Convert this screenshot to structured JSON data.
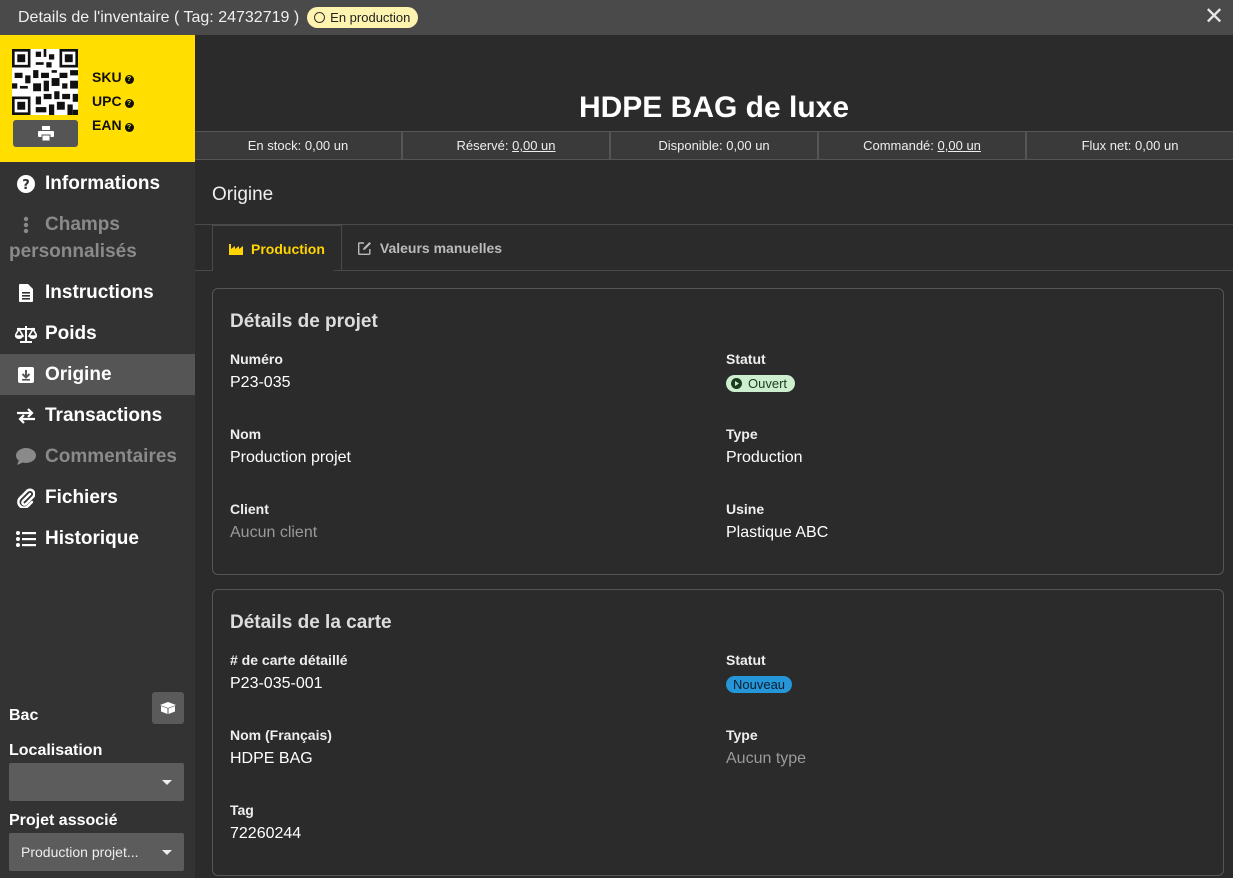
{
  "window": {
    "title": "Details de l'inventaire ( Tag: 24732719 )",
    "status_badge": "En production",
    "close_label": "✕"
  },
  "identifiers": [
    "SKU",
    "UPC",
    "EAN"
  ],
  "nav": {
    "items": [
      {
        "label": "Informations",
        "icon": "question-circle-icon"
      },
      {
        "label": "Champs personnalisés",
        "line1": "Champs",
        "line2": "personnalisés",
        "icon": "vertical-ellipsis-icon",
        "disabled": true
      },
      {
        "label": "Instructions",
        "icon": "document-icon"
      },
      {
        "label": "Poids",
        "icon": "balance-scale-icon"
      },
      {
        "label": "Origine",
        "icon": "download-box-icon",
        "active": true
      },
      {
        "label": "Transactions",
        "icon": "exchange-arrows-icon"
      },
      {
        "label": "Commentaires",
        "icon": "comment-icon",
        "disabled": true
      },
      {
        "label": "Fichiers",
        "icon": "paperclip-icon"
      },
      {
        "label": "Historique",
        "icon": "list-icon"
      }
    ]
  },
  "sidebar_bottom": {
    "bac_label": "Bac",
    "localisation_label": "Localisation",
    "localisation_value": "",
    "projet_label": "Projet associé",
    "projet_value": "Production projet..."
  },
  "header": {
    "product_name": "HDPE BAG de luxe"
  },
  "stats": {
    "en_stock_label": "En stock:",
    "en_stock_value": "0,00 un",
    "reserve_label": "Réservé:",
    "reserve_value": "0,00 un",
    "disponible_label": "Disponible:",
    "disponible_value": "0,00 un",
    "commande_label": "Commandé:",
    "commande_value": "0,00 un",
    "flux_label": "Flux net:",
    "flux_value": "0,00 un"
  },
  "section": {
    "title": "Origine",
    "tabs": [
      {
        "label": "Production",
        "icon": "factory-icon",
        "active": true
      },
      {
        "label": "Valeurs manuelles",
        "icon": "edit-icon"
      }
    ]
  },
  "project_card": {
    "title": "Détails de projet",
    "numero_label": "Numéro",
    "numero_value": "P23-035",
    "statut_label": "Statut",
    "statut_value": "Ouvert",
    "nom_label": "Nom",
    "nom_value": "Production projet",
    "type_label": "Type",
    "type_value": "Production",
    "client_label": "Client",
    "client_value": "Aucun client",
    "usine_label": "Usine",
    "usine_value": "Plastique ABC"
  },
  "card_card": {
    "title": "Détails de la carte",
    "carte_label": "# de carte détaillé",
    "carte_value": "P23-035-001",
    "statut_label": "Statut",
    "statut_value": "Nouveau",
    "nom_label": "Nom (Français)",
    "nom_value": "HDPE BAG",
    "type_label": "Type",
    "type_value": "Aucun type",
    "tag_label": "Tag",
    "tag_value": "72260244"
  },
  "colors": {
    "accent_yellow": "#ffde00",
    "tab_active": "#ffd400",
    "status_open": "#cdeecf",
    "status_new": "#2596d8"
  }
}
